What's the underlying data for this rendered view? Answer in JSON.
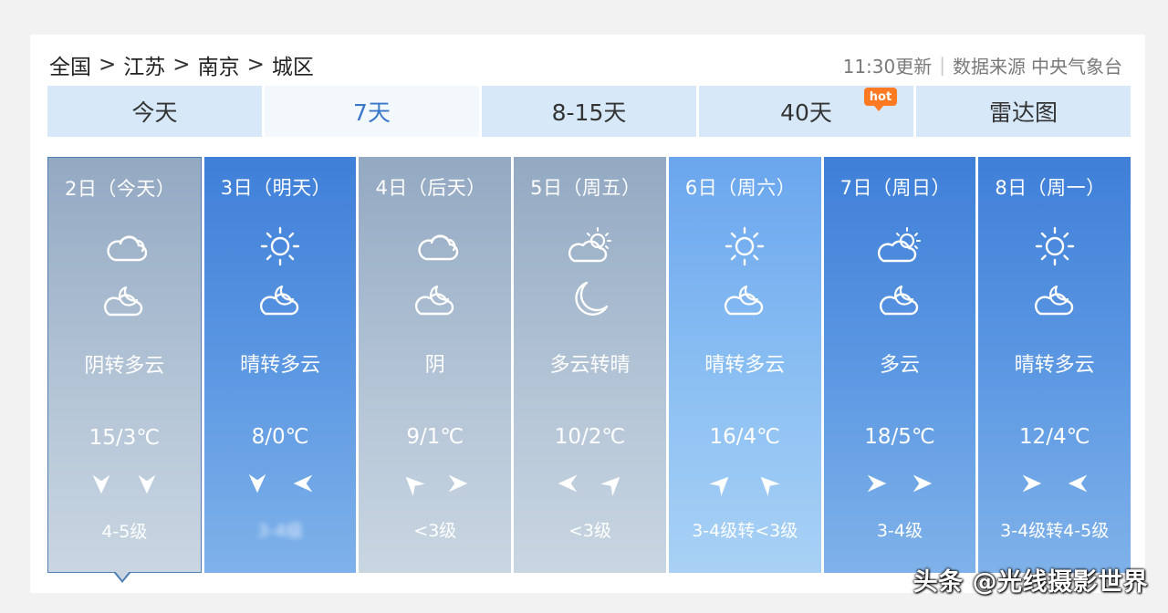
{
  "breadcrumb": [
    {
      "label": "全国"
    },
    {
      "label": "江苏"
    },
    {
      "label": "南京"
    },
    {
      "label": "城区"
    }
  ],
  "breadcrumb_separator": ">",
  "meta": {
    "update_time": "11:30更新",
    "divider": "|",
    "source_label": "数据来源",
    "source_name": "中央气象台"
  },
  "tabs": [
    {
      "label": "今天"
    },
    {
      "label": "7天",
      "active": true
    },
    {
      "label": "8-15天"
    },
    {
      "label": "40天",
      "badge": "hot"
    },
    {
      "label": "雷达图"
    }
  ],
  "days": [
    {
      "date": "2日（今天）",
      "day_icon": "cloudy-icon",
      "night_icon": "partly-cloudy-night-icon",
      "description": "阴转多云",
      "temp": "15/3℃",
      "wind_icons": [
        "wind-arrow-down-icon",
        "wind-arrow-down-icon"
      ],
      "wind_level": "4-5级"
    },
    {
      "date": "3日（明天）",
      "day_icon": "sunny-icon",
      "night_icon": "partly-cloudy-night-icon",
      "description": "晴转多云",
      "temp": "8/0℃",
      "wind_icons": [
        "wind-arrow-down-icon",
        "wind-arrow-left-icon"
      ],
      "wind_level": "3-4级"
    },
    {
      "date": "4日（后天）",
      "day_icon": "cloudy-icon",
      "night_icon": "partly-cloudy-night-icon",
      "description": "阴",
      "temp": "9/1℃",
      "wind_icons": [
        "wind-arrow-up-left-icon",
        "wind-arrow-right-icon"
      ],
      "wind_level": "<3级"
    },
    {
      "date": "5日（周五）",
      "day_icon": "partly-cloudy-day-icon",
      "night_icon": "moon-icon",
      "description": "多云转晴",
      "temp": "10/2℃",
      "wind_icons": [
        "wind-arrow-left-icon",
        "wind-arrow-up-right-icon"
      ],
      "wind_level": "<3级"
    },
    {
      "date": "6日（周六）",
      "day_icon": "sunny-icon",
      "night_icon": "partly-cloudy-night-icon",
      "description": "晴转多云",
      "temp": "16/4℃",
      "wind_icons": [
        "wind-arrow-up-right-icon",
        "wind-arrow-up-left-icon"
      ],
      "wind_level": "3-4级转<3级"
    },
    {
      "date": "7日（周日）",
      "day_icon": "partly-cloudy-day-icon",
      "night_icon": "partly-cloudy-night-icon",
      "description": "多云",
      "temp": "18/5℃",
      "wind_icons": [
        "wind-arrow-right-icon",
        "wind-arrow-right-icon"
      ],
      "wind_level": "3-4级"
    },
    {
      "date": "8日（周一）",
      "day_icon": "sunny-icon",
      "night_icon": "partly-cloudy-night-icon",
      "description": "晴转多云",
      "temp": "12/4℃",
      "wind_icons": [
        "wind-arrow-right-icon",
        "wind-arrow-left-icon"
      ],
      "wind_level": "3-4级转4-5级"
    }
  ],
  "colors": {
    "gray_column": "#a9bccf",
    "blue_column": "#4f8ddf",
    "light_column": "#8cc0f3",
    "tab_bg": "#d7e9f9",
    "active_tab_text": "#3b77c9",
    "hot_badge": "#ff7a22"
  },
  "watermark": "头条 @光线摄影世界"
}
